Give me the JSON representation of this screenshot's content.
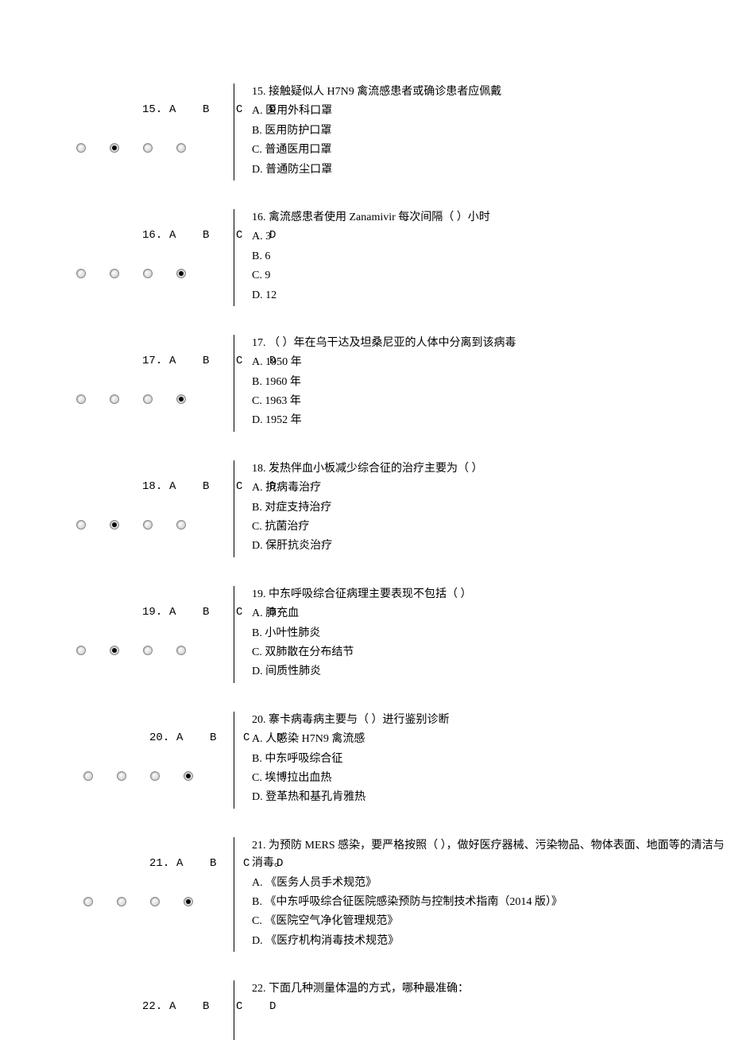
{
  "letters": [
    "A",
    "B",
    "C",
    "D"
  ],
  "questions": [
    {
      "num": "15.",
      "selected": 1,
      "text": "15. 接触疑似人 H7N9 禽流感患者或确诊患者应佩戴",
      "options": [
        "A. 医用外科口罩",
        "B. 医用防护口罩",
        "C. 普通医用口罩",
        "D. 普通防尘口罩"
      ]
    },
    {
      "num": "16.",
      "selected": 3,
      "text": "16. 禽流感患者使用 Zanamivir 每次间隔（ ）小时",
      "options": [
        "A. 3",
        "B. 6",
        "C. 9",
        "D. 12"
      ]
    },
    {
      "num": "17.",
      "selected": 3,
      "text": "17. （ ）年在乌干达及坦桑尼亚的人体中分离到该病毒",
      "options": [
        "A. 1950 年",
        "B. 1960 年",
        "C. 1963 年",
        "D. 1952 年"
      ]
    },
    {
      "num": "18.",
      "selected": 1,
      "text": "18. 发热伴血小板减少综合征的治疗主要为（ ）",
      "options": [
        "A. 抗病毒治疗",
        "B. 对症支持治疗",
        "C. 抗菌治疗",
        "D. 保肝抗炎治疗"
      ]
    },
    {
      "num": "19.",
      "selected": 1,
      "text": "19. 中东呼吸综合征病理主要表现不包括（ ）",
      "options": [
        "A. 肺充血",
        "B. 小叶性肺炎",
        "C. 双肺散在分布结节",
        "D. 间质性肺炎"
      ]
    },
    {
      "num": "20.",
      "selected": 3,
      "text": "20. 寨卡病毒病主要与（ ）进行鉴别诊断",
      "options": [
        "A. 人感染 H7N9 禽流感",
        "B. 中东呼吸综合征",
        "C. 埃博拉出血热",
        "D. 登革热和基孔肯雅热"
      ]
    },
    {
      "num": "21.",
      "selected": 3,
      "text": "21. 为预防 MERS 感染，要严格按照（ ），做好医疗器械、污染物品、物体表面、地面等的清洁与消毒。",
      "options": [
        "A. 《医务人员手术规范》",
        "B. 《中东呼吸综合征医院感染预防与控制技术指南（2014 版）》",
        "C. 《医院空气净化管理规范》",
        "D. 《医疗机构消毒技术规范》"
      ]
    },
    {
      "num": "22.",
      "selected": -1,
      "text": "22. 下面几种测量体温的方式，哪种最准确：",
      "options": []
    }
  ]
}
